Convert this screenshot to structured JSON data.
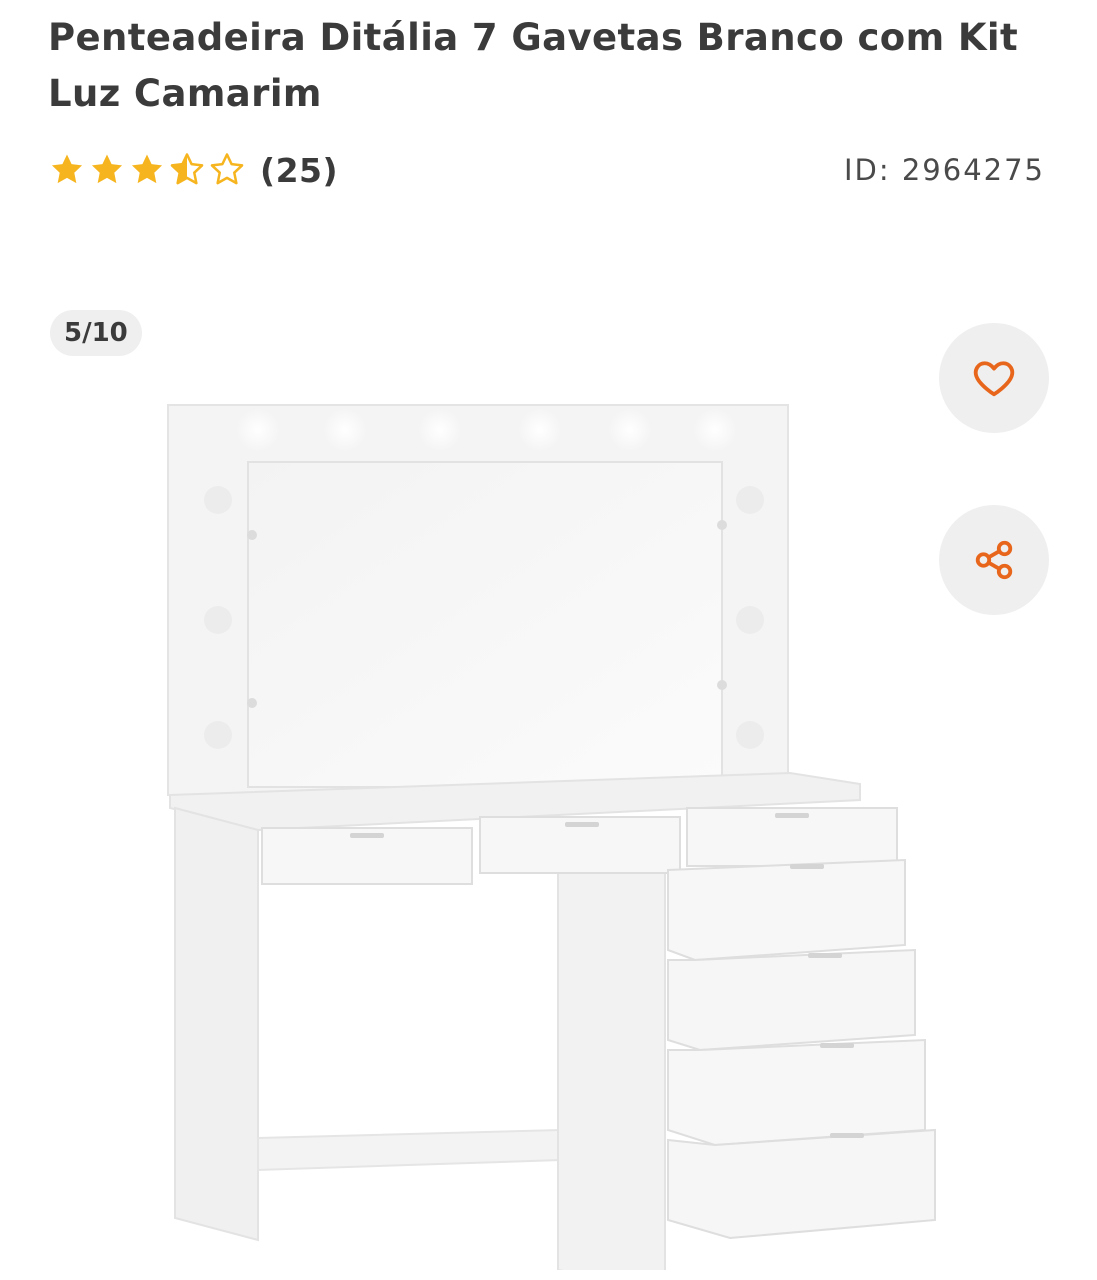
{
  "product": {
    "title": "Penteadeira Ditália 7 Gavetas Branco com Kit Luz Camarim",
    "rating": 3.5,
    "rating_max": 5,
    "review_count": "(25)",
    "id_text": "ID: 2964275"
  },
  "gallery": {
    "counter": "5/10"
  },
  "icons": {
    "star": "star-icon",
    "heart": "heart-icon",
    "share": "share-icon"
  },
  "colors": {
    "star_fill": "#f6b51e",
    "accent": "#e8661b",
    "text": "#3b3b3b",
    "button_bg": "#efefef"
  }
}
